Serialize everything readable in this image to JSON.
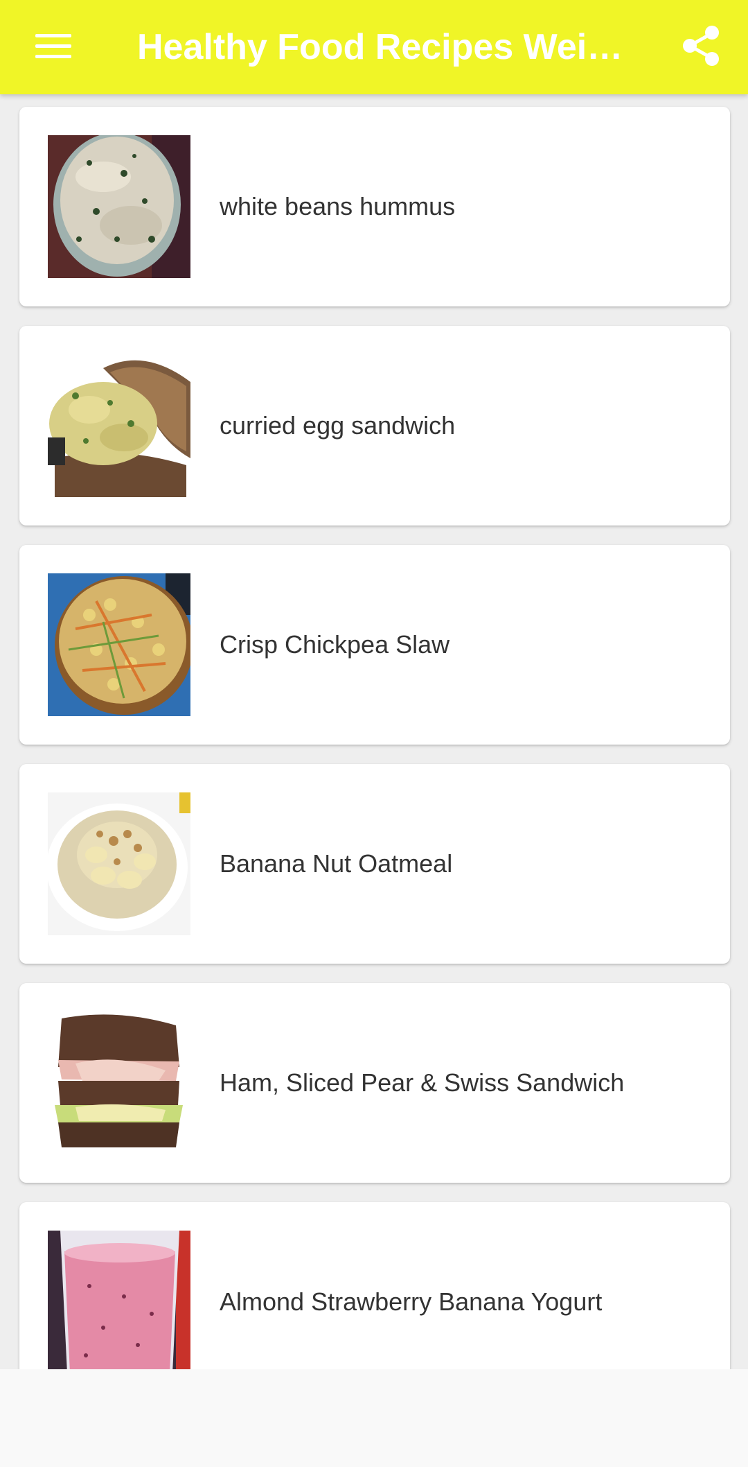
{
  "app": {
    "title": "Healthy Food Recipes Weig...",
    "accent": "#f0f527",
    "menu_icon": "hamburger-menu-icon",
    "share_icon": "share-icon"
  },
  "recipes": [
    {
      "title": "white beans hummus"
    },
    {
      "title": "curried egg sandwich"
    },
    {
      "title": "Crisp Chickpea Slaw"
    },
    {
      "title": "Banana Nut Oatmeal"
    },
    {
      "title": "Ham, Sliced Pear & Swiss Sandwich"
    },
    {
      "title": "Almond Strawberry Banana Yogurt"
    }
  ]
}
